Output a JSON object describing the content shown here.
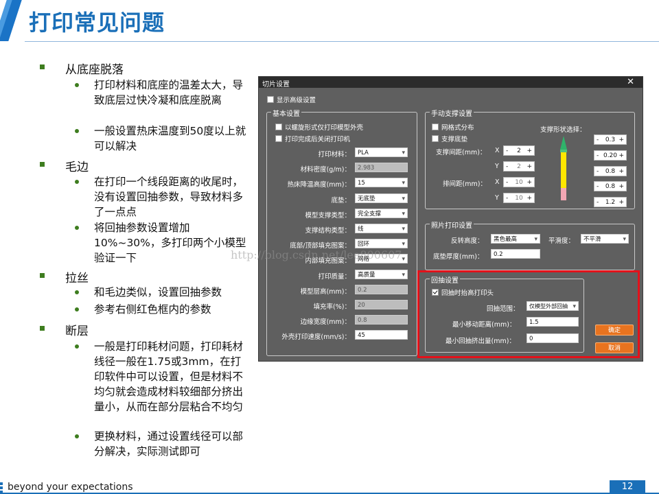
{
  "slide": {
    "title": "打印常见问题",
    "footer_text": "beyond your expectations",
    "page_number": "12",
    "watermark": "http://blog.csdn.net/lee800607"
  },
  "bullets": [
    {
      "text": "从底座脱落",
      "subs": [
        "打印材料和底座的温差太大，导致底层过快冷凝和底座脱离",
        "一般设置热床温度到50度以上就可以解决"
      ]
    },
    {
      "text": "毛边",
      "subs": [
        "在打印一个线段距离的收尾时，没有设置回抽参数，导致材料多了一点点",
        "将回抽参数设置增加10%~30%，多打印两个小模型验证一下"
      ]
    },
    {
      "text": "拉丝",
      "subs": [
        "和毛边类似，设置回抽参数",
        "参考右侧红色框内的参数"
      ]
    },
    {
      "text": "断层",
      "subs": [
        "一般是打印耗材问题，打印耗材线径一般在1.75或3mm，在打印软件中可以设置，但是材料不均匀就会造成材料较细部分挤出量小，从而在部分层粘合不均匀",
        "更换材料，通过设置线径可以部分解决，实际测试即可"
      ]
    }
  ],
  "dialog": {
    "title": "切片设置",
    "close": "✕",
    "show_advanced": "显示高级设置",
    "basic": {
      "title": "基本设置",
      "spiral": "以螺旋形式仅打印模型外壳",
      "shutdown": "打印完成后关闭打印机",
      "rows": [
        {
          "label": "打印材料：",
          "value": "PLA",
          "kind": "select"
        },
        {
          "label": "材料密度(g/m)：",
          "value": "2.983",
          "kind": "disabled"
        },
        {
          "label": "热床降温高度(mm)：",
          "value": "15",
          "kind": "select"
        },
        {
          "label": "底垫：",
          "value": "无底垫",
          "kind": "select"
        },
        {
          "label": "模型支撑类型：",
          "value": "完全支撑",
          "kind": "select"
        },
        {
          "label": "支撑结构类型：",
          "value": "线",
          "kind": "select"
        },
        {
          "label": "底部/顶部填充图案：",
          "value": "回环",
          "kind": "select"
        },
        {
          "label": "内部填充图案：",
          "value": "网格",
          "kind": "select"
        },
        {
          "label": "打印质量：",
          "value": "高质量",
          "kind": "select"
        },
        {
          "label": "模型层高(mm)：",
          "value": "0.2",
          "kind": "disabled"
        },
        {
          "label": "填充率(%)：",
          "value": "20",
          "kind": "disabled"
        },
        {
          "label": "边缘宽度(mm)：",
          "value": "0.8",
          "kind": "disabled"
        },
        {
          "label": "外壳打印速度(mm/s)：",
          "value": "45",
          "kind": "input"
        }
      ]
    },
    "manual": {
      "title": "手动支撑设置",
      "grid": "网格式分布",
      "base": "支撑底垫",
      "shape_label": "支撑形状选择：",
      "support_spacing": "支撑间距(mm)：",
      "row_spacing": "排间距(mm)：",
      "x": "X",
      "y": "Y",
      "sx": "2",
      "sy": "2",
      "rx": "10",
      "ry": "10",
      "shape_values": [
        "0.3",
        "0.20",
        "0.8",
        "0.8",
        "1.2"
      ]
    },
    "photo": {
      "title": "照片打印设置",
      "reverse_label": "反转高度：",
      "reverse_value": "黑色最高",
      "smooth_label": "平滑度：",
      "smooth_value": "不平滑",
      "base_label": "底垫厚度(mm)：",
      "base_value": "0.2"
    },
    "retract": {
      "title": "回抽设置",
      "lift": "回抽时抬高打印头",
      "range_label": "回抽范围：",
      "range_value": "仅模型外部回抽",
      "min_move_label": "最小移动距离(mm)：",
      "min_move_value": "1.5",
      "min_extrude_label": "最小回抽挤出量(mm)：",
      "min_extrude_value": "0"
    },
    "ok": "确定",
    "cancel": "取消"
  },
  "colors": {
    "accent": "#1a6fb8",
    "bullet": "#3e7d1f",
    "highlight": "#e3111a",
    "button": "#e8731f",
    "dialog_bg": "#5f5f5f"
  }
}
